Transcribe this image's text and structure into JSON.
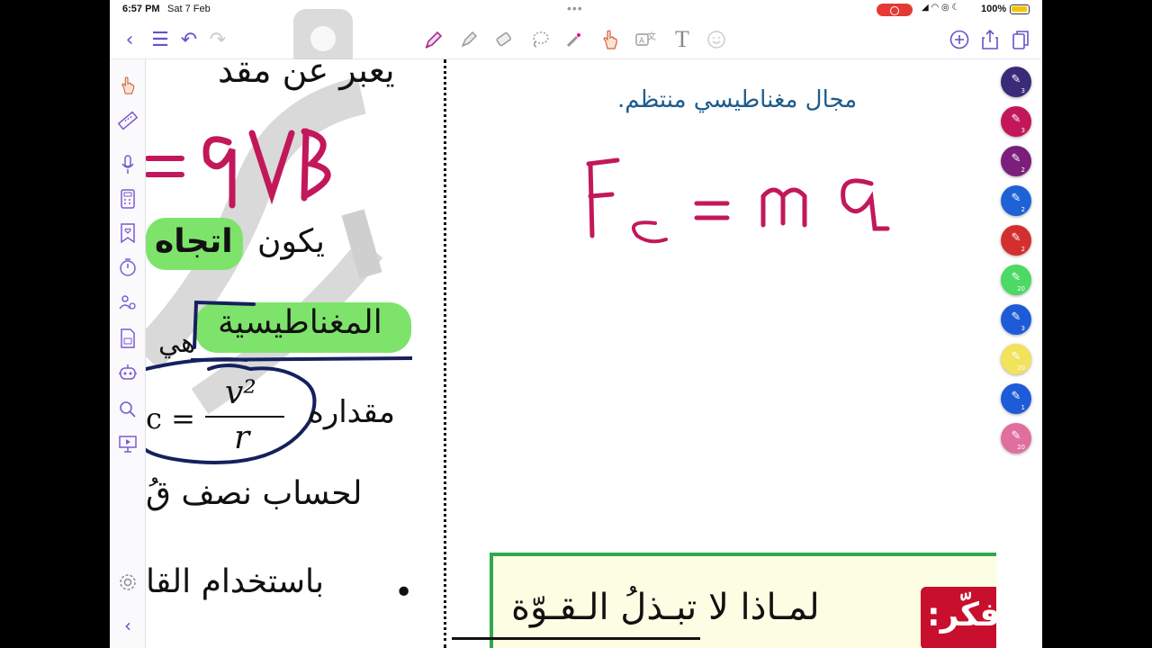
{
  "status": {
    "time": "6:57 PM",
    "date": "Sat 7 Feb",
    "battery": "100%"
  },
  "toolbar": {
    "left": [
      "chevron-left-icon",
      "list-icon",
      "undo-icon",
      "redo-icon"
    ],
    "tools": [
      "pen-icon",
      "highlighter-icon",
      "eraser-icon",
      "lasso-icon",
      "laser-pointer-icon",
      "hand-icon",
      "translate-icon",
      "text-icon",
      "sticker-icon"
    ],
    "right": [
      "add-page-icon",
      "share-icon",
      "pages-icon"
    ]
  },
  "sidebar": [
    "hand-icon",
    "ruler-icon",
    "microphone-icon",
    "calculator-icon",
    "bookmark-heart-icon",
    "timer-icon",
    "people-icon",
    "document-icon",
    "assistant-icon",
    "search-icon",
    "presentation-icon",
    "settings-icon",
    "collapse-icon"
  ],
  "palette": [
    {
      "color": "#3b2a78",
      "width": "3"
    },
    {
      "color": "#c2185b",
      "width": "3"
    },
    {
      "color": "#7b1f7a",
      "width": "2"
    },
    {
      "color": "#1e63d6",
      "width": "2"
    },
    {
      "color": "#d32f2f",
      "width": "2"
    },
    {
      "color": "#4cd964",
      "width": "20"
    },
    {
      "color": "#1e5bd8",
      "width": "3"
    },
    {
      "color": "#f1e35a",
      "width": "20"
    },
    {
      "color": "#1e5bd8",
      "width": "1"
    },
    {
      "color": "#e06fa0",
      "width": "20"
    }
  ],
  "left_column": {
    "line1": "يعبر عن مقد",
    "handwriting_formula": "= qVB",
    "line2_main": "يكون",
    "line2_highlight": "اتجاه",
    "line3_highlight": "المغناطيسية",
    "line3_rest": "هي",
    "line4": "مقداره",
    "fraction_prefix": "c =",
    "fraction_num": "v²",
    "fraction_den": "r",
    "line5": "لحساب نصف قُ",
    "bullet": "•",
    "line6": "باستخدام القا"
  },
  "right_column": {
    "heading": "مجال مغناطيسي منتظم.",
    "handwriting_formula": "Fc = ma"
  },
  "think_box": {
    "badge": "أُفكّر:",
    "text": "لمـاذا لا تبـذلُ الـقـوّة"
  }
}
